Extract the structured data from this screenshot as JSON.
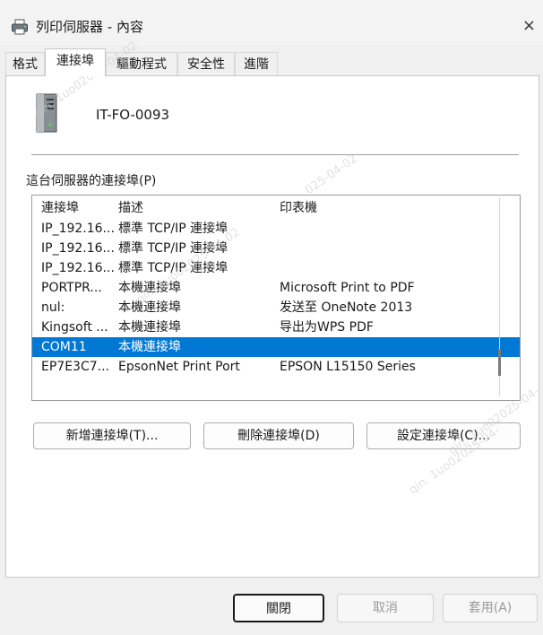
{
  "window": {
    "title": "列印伺服器 - 內容",
    "close_glyph": "×"
  },
  "tabs": [
    {
      "label": "格式",
      "active": false
    },
    {
      "label": "連接埠",
      "active": true
    },
    {
      "label": "驅動程式",
      "active": false
    },
    {
      "label": "安全性",
      "active": false
    },
    {
      "label": "進階",
      "active": false
    }
  ],
  "server_name": "IT-FO-0093",
  "ports_label": "這台伺服器的連接埠(P)",
  "columns": {
    "port": "連接埠",
    "description": "描述",
    "printer": "印表機"
  },
  "rows": [
    {
      "port": "IP_192.16...",
      "description": "標準 TCP/IP 連接埠",
      "printer": "",
      "selected": false
    },
    {
      "port": "IP_192.16...",
      "description": "標準 TCP/IP 連接埠",
      "printer": "",
      "selected": false
    },
    {
      "port": "IP_192.16...",
      "description": "標準 TCP/IP 連接埠",
      "printer": "",
      "selected": false
    },
    {
      "port": "PORTPR...",
      "description": "本機連接埠",
      "printer": "Microsoft Print to PDF",
      "selected": false
    },
    {
      "port": "nul:",
      "description": "本機連接埠",
      "printer": "发送至 OneNote 2013",
      "selected": false
    },
    {
      "port": "Kingsoft ...",
      "description": "本機連接埠",
      "printer": "导出为WPS PDF",
      "selected": false
    },
    {
      "port": "COM11",
      "description": "本機連接埠",
      "printer": "",
      "selected": true
    },
    {
      "port": "EP7E3C7...",
      "description": "EpsonNet Print Port",
      "printer": "EPSON L15150 Series",
      "selected": false
    }
  ],
  "actions": {
    "add": "新增連接埠(T)...",
    "delete": "刪除連接埠(D)",
    "configure": "設定連接埠(C)..."
  },
  "footer": {
    "close": "關閉",
    "cancel": "取消",
    "apply": "套用(A)"
  },
  "watermarks": [
    "qin. 1uo02025-04-02",
    "025-04-02",
    "qin. 1uo02025-04-02",
    "qin. 1uo02025-04-",
    "qin. 1uo02025-04-"
  ],
  "colors": {
    "selection": "#0078d4",
    "dialog_bg": "#f0f0f0",
    "panel_bg": "#ffffff"
  },
  "icons": {
    "title": "printer-icon",
    "server": "server-tower-icon"
  }
}
